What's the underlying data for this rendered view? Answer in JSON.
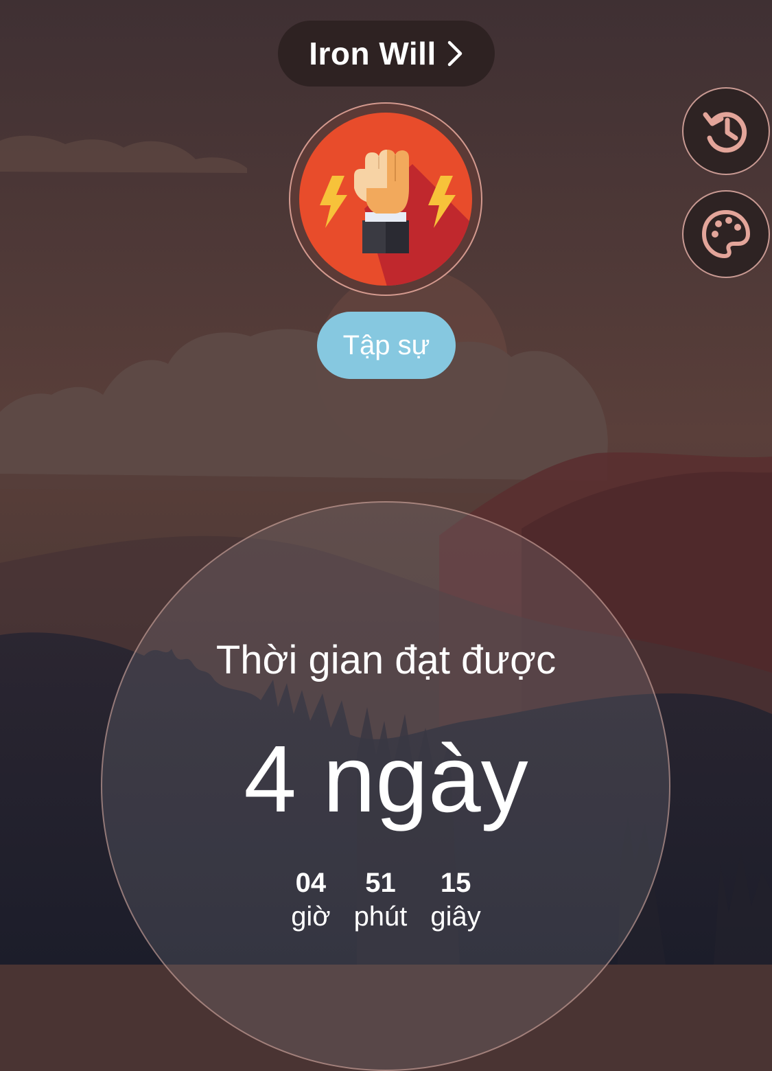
{
  "header": {
    "title": "Iron Will",
    "chevron_icon": "chevron-right-icon"
  },
  "side_buttons": {
    "history_icon": "history-icon",
    "theme_icon": "palette-icon",
    "icon_color": "#e3a59a"
  },
  "badge": {
    "icon": "raised-fist-lightning-icon",
    "color": "#e84c2b"
  },
  "rank": {
    "label": "Tập sự",
    "color": "#86c8e0"
  },
  "timer": {
    "label": "Thời gian đạt được",
    "days": "4 ngày",
    "units": [
      {
        "value": "04",
        "name": "giờ"
      },
      {
        "value": "51",
        "name": "phút"
      },
      {
        "value": "15",
        "name": "giây"
      }
    ]
  }
}
